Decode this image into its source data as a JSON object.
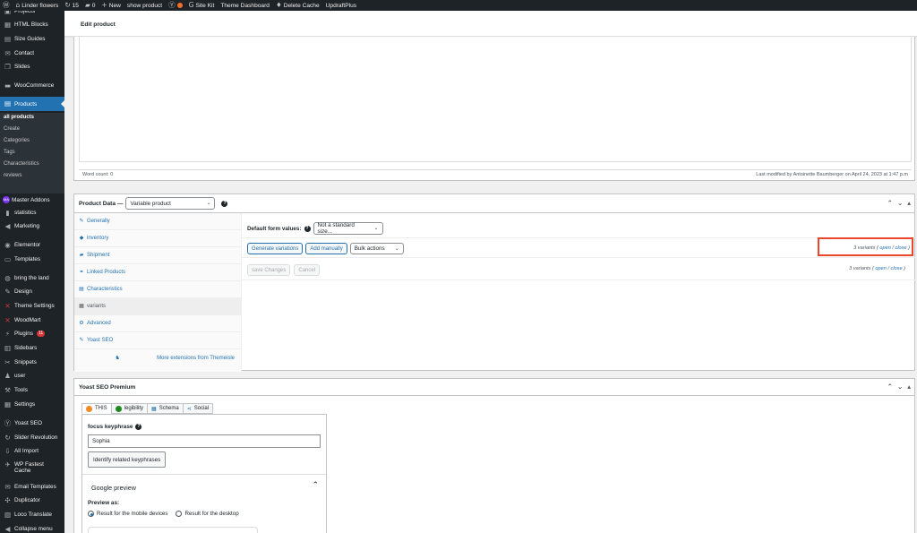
{
  "admin_bar": {
    "wp_icon": "wordpress-icon",
    "site_name": "Linder flowers",
    "updates_count": "15",
    "comments_count": "0",
    "new_label": "New",
    "show_product": "show product",
    "site_kit": "Site Kit",
    "theme_dashboard": "Theme Dashboard",
    "delete_cache": "Delete Cache",
    "updraft": "UpdraftPlus"
  },
  "sidebar": {
    "items": [
      {
        "label": "Projects",
        "icon": "projects-icon",
        "glyph": "▣"
      },
      {
        "label": "HTML Blocks",
        "icon": "html-blocks-icon",
        "glyph": "▦"
      },
      {
        "label": "Size Guides",
        "icon": "size-guides-icon",
        "glyph": "▤"
      },
      {
        "label": "Contact",
        "icon": "mail-icon",
        "glyph": "✉"
      },
      {
        "label": "Slides",
        "icon": "slides-icon",
        "glyph": "❐"
      },
      {
        "label": "WooCommerce",
        "icon": "woocommerce-icon",
        "glyph": "▬"
      },
      {
        "label": "Products",
        "icon": "products-icon",
        "glyph": "▤"
      },
      {
        "label": "Master Addons",
        "icon": "master-addons-icon",
        "glyph": "MA"
      },
      {
        "label": "statistics",
        "icon": "bar-chart-icon",
        "glyph": "▮"
      },
      {
        "label": "Marketing",
        "icon": "megaphone-icon",
        "glyph": "◀"
      },
      {
        "label": "Elementor",
        "icon": "elementor-icon",
        "glyph": "◉"
      },
      {
        "label": "Templates",
        "icon": "folder-icon",
        "glyph": "▭"
      },
      {
        "label": "bring the land",
        "icon": "globe-icon",
        "glyph": "◍"
      },
      {
        "label": "Design",
        "icon": "brush-icon",
        "glyph": "✎"
      },
      {
        "label": "Theme Settings",
        "icon": "theme-settings-icon",
        "glyph": "✕"
      },
      {
        "label": "WoodMart",
        "icon": "woodmart-icon",
        "glyph": "✕"
      },
      {
        "label": "Plugins",
        "icon": "plugin-icon",
        "glyph": "⚡"
      },
      {
        "label": "Sidebars",
        "icon": "sidebars-icon",
        "glyph": "▥"
      },
      {
        "label": "Snippets",
        "icon": "snippets-icon",
        "glyph": "✂"
      },
      {
        "label": "user",
        "icon": "user-icon",
        "glyph": "♟"
      },
      {
        "label": "Tools",
        "icon": "wrench-icon",
        "glyph": "⚒"
      },
      {
        "label": "Settings",
        "icon": "settings-icon",
        "glyph": "▦"
      },
      {
        "label": "Yoast SEO",
        "icon": "yoast-icon",
        "glyph": "Ⓨ"
      },
      {
        "label": "Slider Revolution",
        "icon": "refresh-icon",
        "glyph": "↻"
      },
      {
        "label": "All Import",
        "icon": "import-icon",
        "glyph": "⇩"
      },
      {
        "label": "WP Fastest",
        "label2": "Cache",
        "icon": "rocket-icon",
        "glyph": "✈"
      },
      {
        "label": "Email Templates",
        "icon": "email-icon",
        "glyph": "✉"
      },
      {
        "label": "Duplicator",
        "icon": "duplicator-icon",
        "glyph": "✣"
      },
      {
        "label": "Loco Translate",
        "icon": "translate-icon",
        "glyph": "▧"
      },
      {
        "label": "Collapse menu",
        "icon": "collapse-icon",
        "glyph": "◀"
      }
    ],
    "plugins_badge": "11",
    "products_submenu": [
      "all products",
      "Create",
      "Categories",
      "Tags",
      "Characteristics",
      "reviews"
    ]
  },
  "header": {
    "title": "Edit product"
  },
  "editor": {
    "word_count": "Word count: 0",
    "last_modified": "Last modified by Antoinette Baumberger on April 24, 2023 at 1:47 p.m"
  },
  "product_data": {
    "title": "Product Data —",
    "type_select": "Variable product",
    "tabs": [
      {
        "label": "Generally",
        "glyph": "✎",
        "icon": "pencil-icon"
      },
      {
        "label": "inventory",
        "glyph": "◆",
        "icon": "inventory-icon"
      },
      {
        "label": "Shipment",
        "glyph": "▰",
        "icon": "truck-icon"
      },
      {
        "label": "Linked Products",
        "glyph": "⚭",
        "icon": "link-icon"
      },
      {
        "label": "Characteristics",
        "glyph": "▤",
        "icon": "list-icon"
      },
      {
        "label": "variants",
        "glyph": "▦",
        "icon": "grid-icon"
      },
      {
        "label": "Advanced",
        "glyph": "⚙",
        "icon": "gear-icon"
      },
      {
        "label": "Yoast SEO",
        "glyph": "✎",
        "icon": "yoast-icon"
      }
    ],
    "ext_label": "More extensions from Themeisle",
    "default_form_label": "Default form values:",
    "default_form_select": "Not a standard size...",
    "generate_variations": "Generate variations",
    "add_manually": "Add manually",
    "bulk_actions": "Bulk actions",
    "variants_count": "3 variants",
    "open": "open",
    "close": "close",
    "save_changes": "save Changes",
    "cancel": "Cancel"
  },
  "yoast": {
    "title": "Yoast SEO Premium",
    "tabs": [
      {
        "label": "THIS",
        "color": "#f08a24"
      },
      {
        "label": "legibility",
        "color": "#1e8a1e"
      },
      {
        "label": "Schema",
        "color": "#2271b1"
      },
      {
        "label": "Social",
        "color": "#2271b1"
      }
    ],
    "focus_label": "focus keyphrase",
    "focus_value": "Sophia",
    "related_btn": "Identify related keyphrases",
    "google_preview": "Google preview",
    "preview_as": "Preview as:",
    "mobile": "Result for the mobile devices",
    "desktop": "Result for the desktop"
  },
  "colors": {
    "accent": "#2271b1",
    "admin_bar": "#1d2327",
    "highlight": "#e8472c"
  }
}
